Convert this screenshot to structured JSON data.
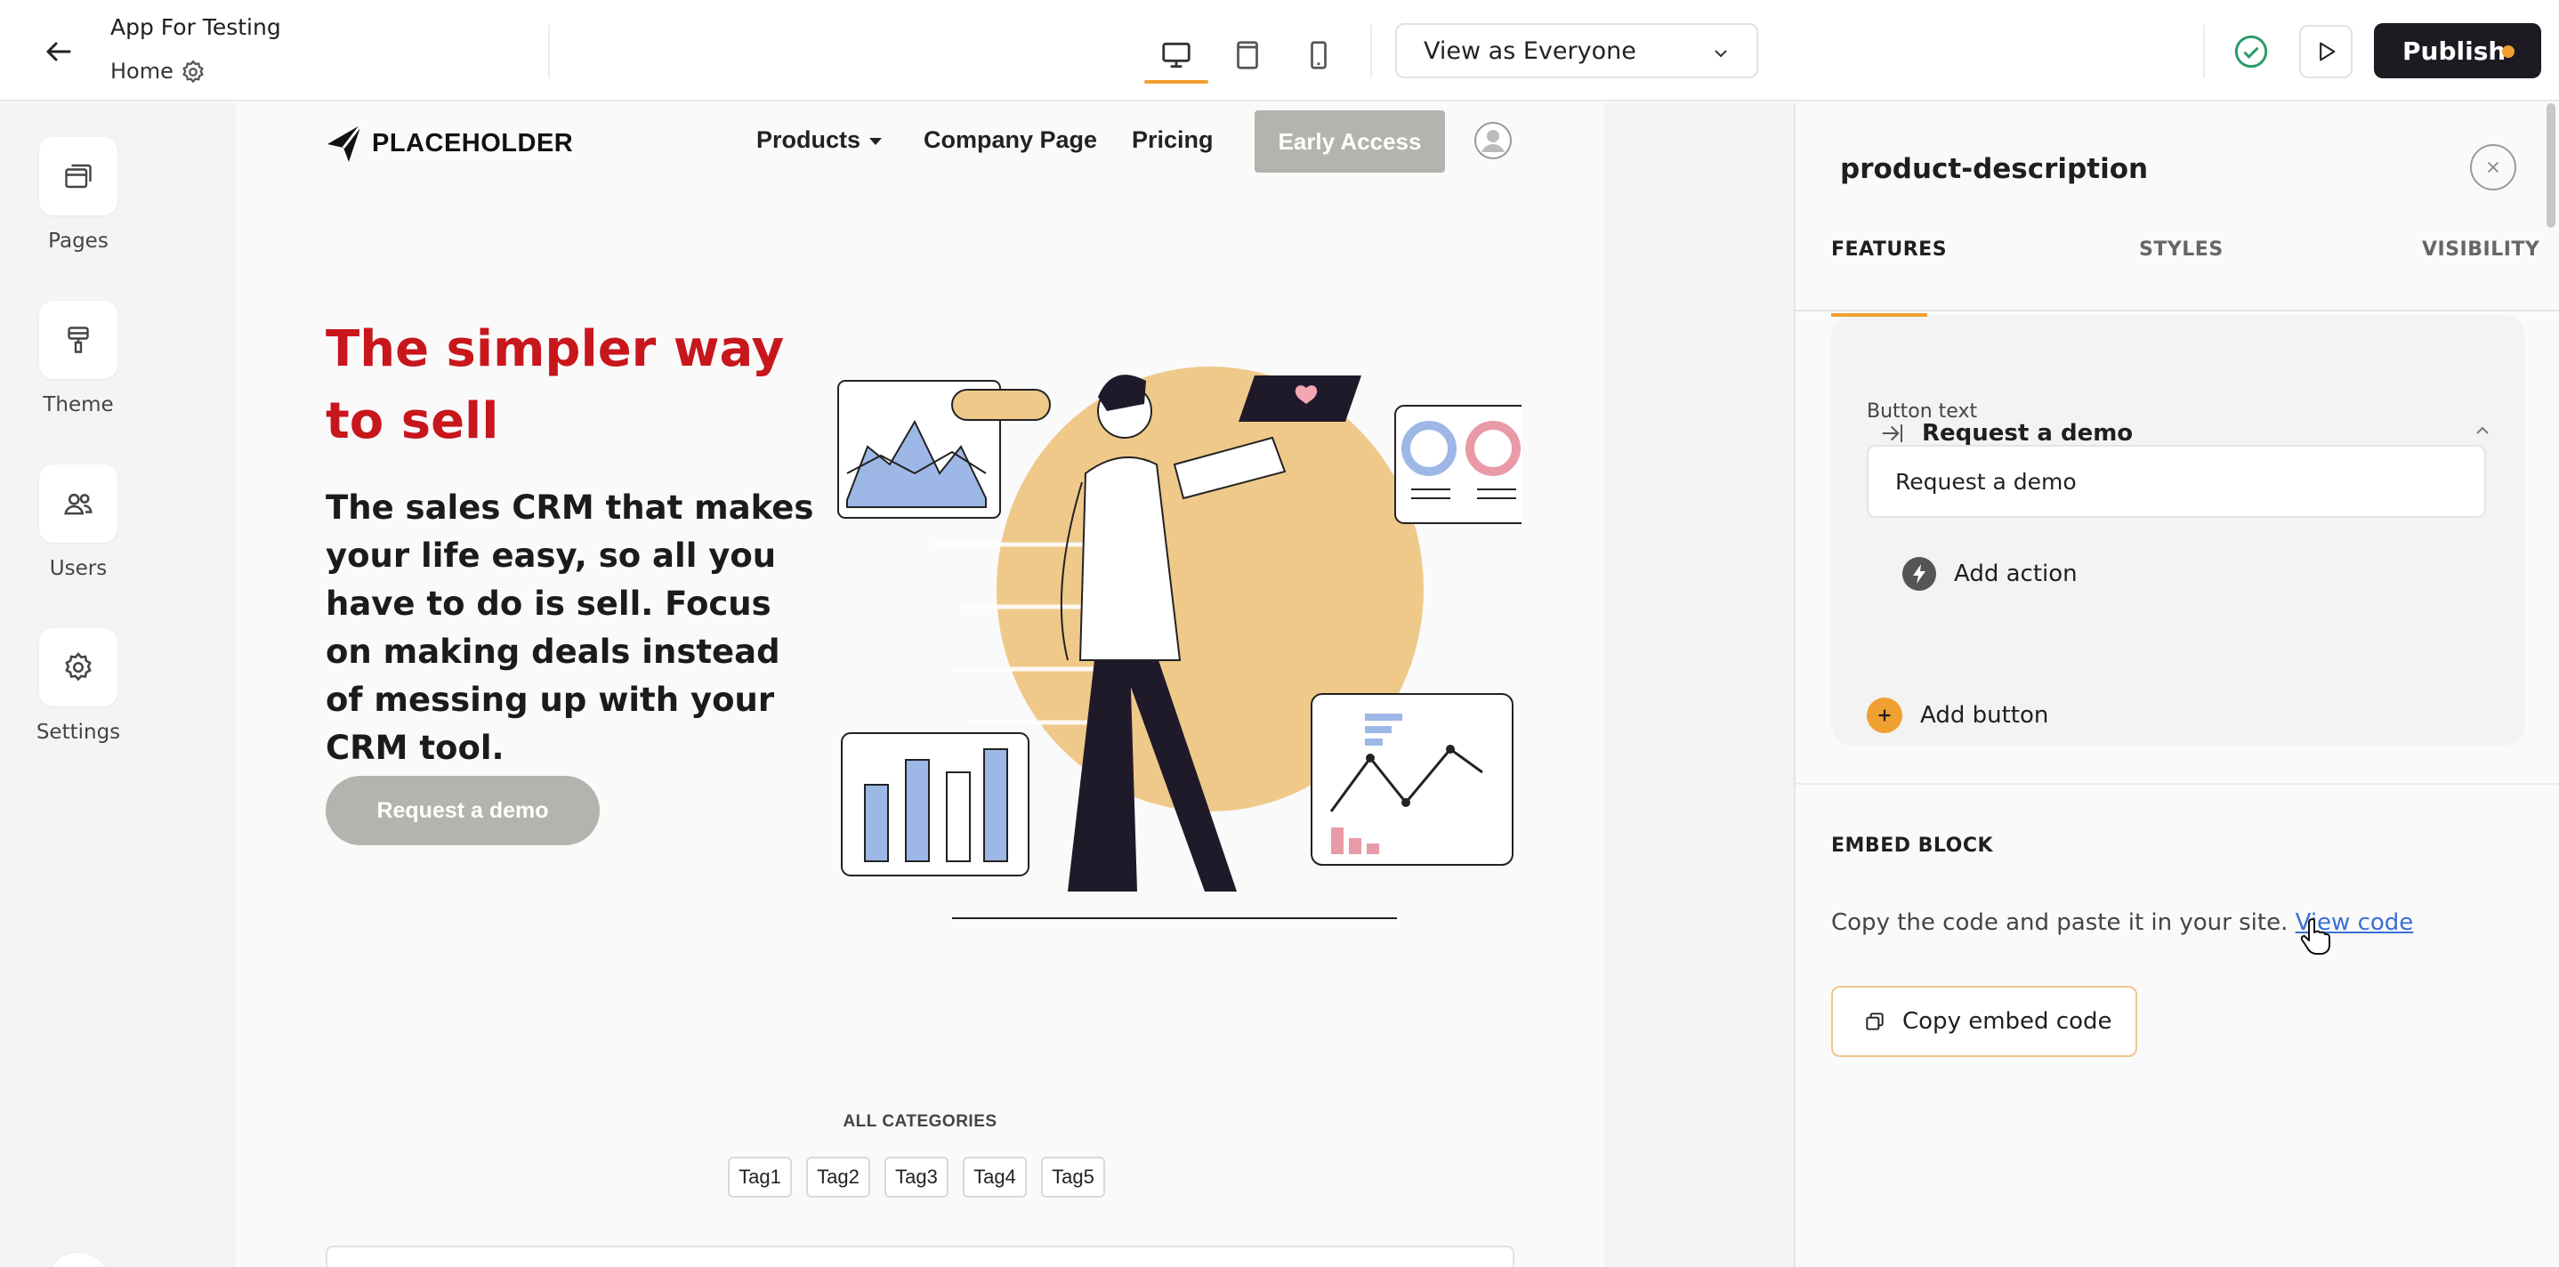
{
  "topbar": {
    "app_title": "App For Testing",
    "page_name": "Home",
    "view_select": "View as Everyone",
    "publish_label": "Publish",
    "accent": "#f0a030"
  },
  "sidebar": {
    "items": [
      {
        "label": "Pages",
        "icon": "pages-icon"
      },
      {
        "label": "Theme",
        "icon": "paint-roller-icon"
      },
      {
        "label": "Users",
        "icon": "users-icon"
      },
      {
        "label": "Settings",
        "icon": "gear-icon"
      }
    ]
  },
  "site": {
    "logo_text": "PLACEHOLDER",
    "nav": [
      "Products",
      "Company Page",
      "Pricing"
    ],
    "early_access": "Early Access",
    "hero_title": "The simpler way to sell",
    "hero_title_color": "#c8161d",
    "hero_subtitle": "The sales CRM that makes your life easy, so all you have to do is sell. Focus on making deals instead of messing up with your CRM tool.",
    "hero_cta": "Request a demo",
    "all_categories": "ALL CATEGORIES",
    "tags": [
      "Tag1",
      "Tag2",
      "Tag3",
      "Tag4",
      "Tag5"
    ]
  },
  "panel": {
    "title": "product-description",
    "tabs": [
      "FEATURES",
      "STYLES",
      "VISIBILITY"
    ],
    "button_card_title": "Request a demo",
    "button_text_label": "Button text",
    "button_text_value": "Request a demo",
    "add_action": "Add action",
    "add_button": "Add button",
    "embed_title": "EMBED BLOCK",
    "embed_desc": "Copy the code and paste it in your site.",
    "embed_link": "View code",
    "copy_embed": "Copy embed code"
  }
}
